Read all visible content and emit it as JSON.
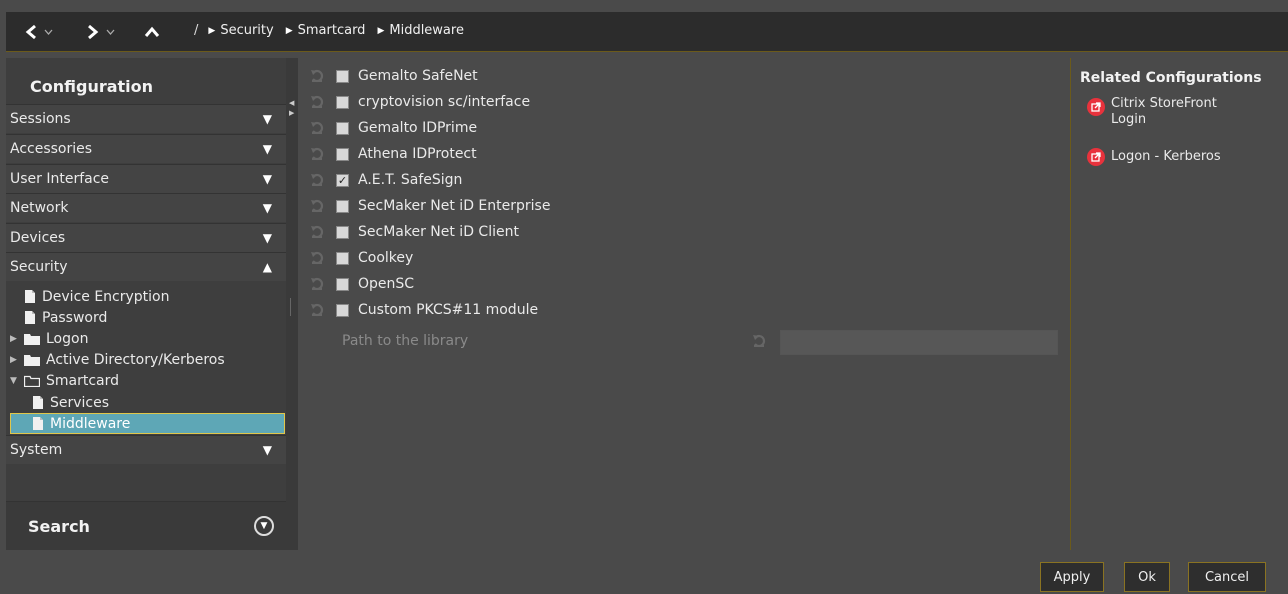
{
  "nav": {
    "back_icon": "chevron-left-icon",
    "forward_icon": "chevron-right-icon",
    "up_icon": "chevron-up-icon",
    "root_sep": "/",
    "breadcrumbs": [
      "Security",
      "Smartcard",
      "Middleware"
    ]
  },
  "sidebar": {
    "title": "Configuration",
    "sections": [
      {
        "label": "Sessions",
        "state": "collapsed"
      },
      {
        "label": "Accessories",
        "state": "collapsed"
      },
      {
        "label": "User Interface",
        "state": "collapsed"
      },
      {
        "label": "Network",
        "state": "collapsed"
      },
      {
        "label": "Devices",
        "state": "collapsed"
      },
      {
        "label": "Security",
        "state": "expanded"
      },
      {
        "label": "System",
        "state": "collapsed"
      }
    ],
    "security_tree": [
      {
        "label": "Device Encryption",
        "type": "page"
      },
      {
        "label": "Password",
        "type": "page"
      },
      {
        "label": "Logon",
        "type": "folder",
        "expanded": false
      },
      {
        "label": "Active Directory/Kerberos",
        "type": "folder",
        "expanded": false
      },
      {
        "label": "Smartcard",
        "type": "folder",
        "expanded": true
      },
      {
        "label": "Services",
        "type": "page"
      },
      {
        "label": "Middleware",
        "type": "page",
        "selected": true
      }
    ],
    "search_label": "Search"
  },
  "middleware": {
    "items": [
      {
        "label": "Gemalto SafeNet",
        "checked": false
      },
      {
        "label": "cryptovision sc/interface",
        "checked": false
      },
      {
        "label": "Gemalto IDPrime",
        "checked": false
      },
      {
        "label": "Athena IDProtect",
        "checked": false
      },
      {
        "label": "A.E.T. SafeSign",
        "checked": true
      },
      {
        "label": "SecMaker Net iD Enterprise",
        "checked": false
      },
      {
        "label": "SecMaker Net iD Client",
        "checked": false
      },
      {
        "label": "Coolkey",
        "checked": false
      },
      {
        "label": "OpenSC",
        "checked": false
      },
      {
        "label": "Custom PKCS#11 module",
        "checked": false
      }
    ],
    "path_label": "Path to the library",
    "path_value": ""
  },
  "related": {
    "title": "Related Configurations",
    "items": [
      "Citrix StoreFront Login",
      "Logon - Kerberos"
    ]
  },
  "buttons": {
    "apply": "Apply",
    "ok": "Ok",
    "cancel": "Cancel"
  },
  "colors": {
    "selection": "#5ea7b6",
    "accent_border": "#e0c64a",
    "link_badge": "#e8323c"
  }
}
